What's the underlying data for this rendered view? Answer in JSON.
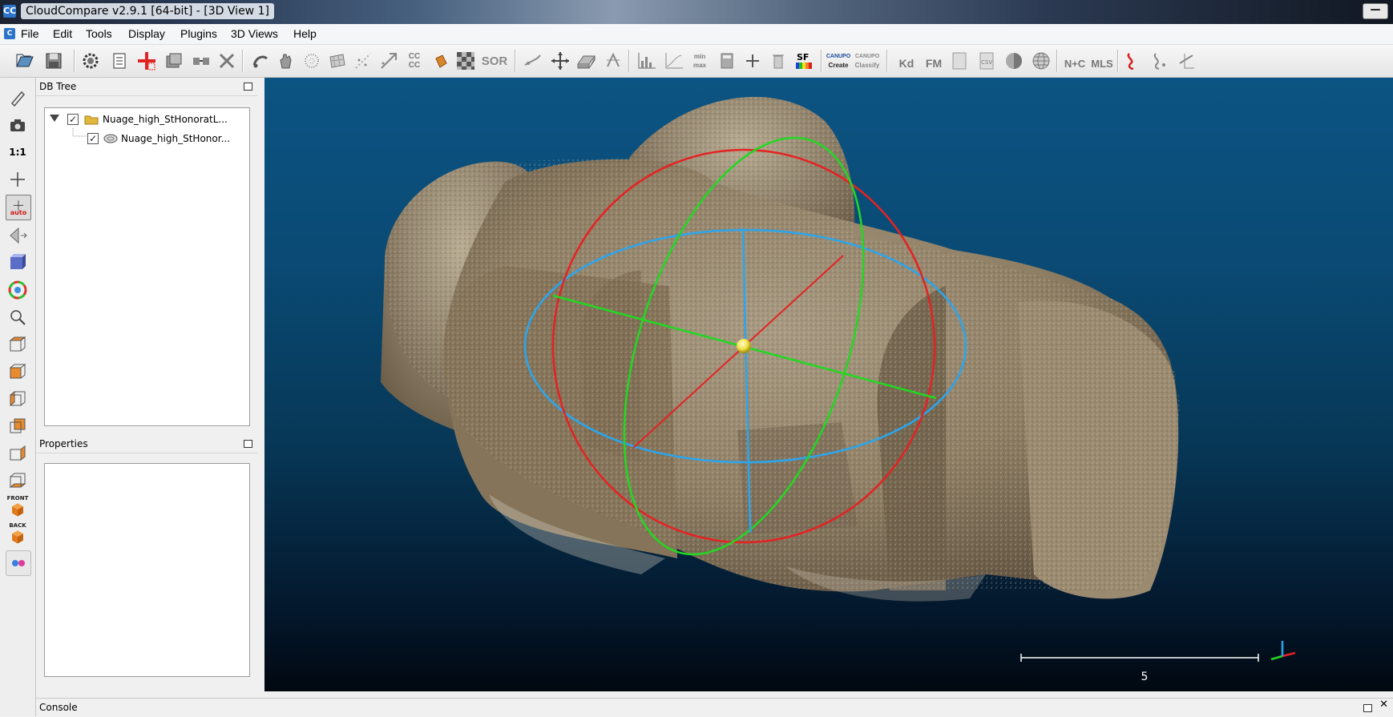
{
  "window": {
    "title": "CloudCompare v2.9.1 [64-bit] - [3D View 1]",
    "app_icon": "CC"
  },
  "menu": {
    "items": [
      "File",
      "Edit",
      "Tools",
      "Display",
      "Plugins",
      "3D Views",
      "Help"
    ]
  },
  "toolbar": {
    "sf_label": "SF",
    "sor_label": "SOR",
    "cc_label": "CC CC",
    "minmax_label": "min max",
    "canupo_create": "Create",
    "canupo_classify": "Classify",
    "canupo_title": "CANUPO",
    "kd_label": "Kd",
    "fm_label": "FM",
    "nc_label": "N+C",
    "mls_label": "MLS"
  },
  "left_toolbar": {
    "ratio_label": "1:1",
    "auto_label": "auto",
    "front_label": "FRONT",
    "back_label": "BACK"
  },
  "db_tree": {
    "title": "DB Tree",
    "root_label": "Nuage_high_StHonoratL...",
    "child_label": "Nuage_high_StHonor..."
  },
  "properties": {
    "title": "Properties"
  },
  "view3d": {
    "scale_label": "5",
    "background_top": "#0c5483",
    "background_bottom": "#010810"
  },
  "console": {
    "title": "Console"
  },
  "colors": {
    "axis_red": "#e52222",
    "axis_green": "#22d822",
    "axis_blue": "#2aa6ee",
    "center_ball": "#f2e24a",
    "point_cloud": "#8e7e64"
  }
}
